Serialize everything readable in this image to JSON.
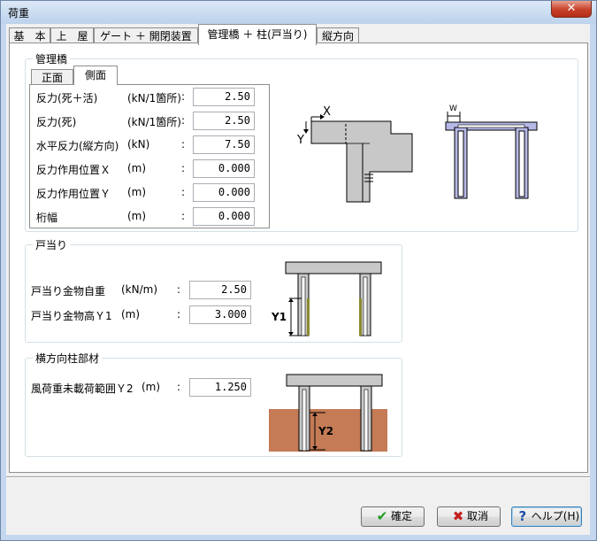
{
  "window": {
    "title": "荷重"
  },
  "tabs": [
    {
      "label": "基　本"
    },
    {
      "label": "上　屋"
    },
    {
      "label": "ゲート ＋ 開閉装置"
    },
    {
      "label": "管理橋 ＋ 柱(戸当り)"
    },
    {
      "label": "縦方向"
    }
  ],
  "group_kanri": {
    "title": "管理橋",
    "subtabs": [
      {
        "label": "正面"
      },
      {
        "label": "側面"
      }
    ],
    "rows": [
      {
        "label": "反力(死＋活)",
        "unit": "(kN/1箇所)",
        "colon": ":",
        "value": "2.50"
      },
      {
        "label": "反力(死)",
        "unit": "(kN/1箇所)",
        "colon": ":",
        "value": "2.50"
      },
      {
        "label": "水平反力(縦方向)",
        "unit": "(kN)",
        "colon": ":",
        "value": "7.50"
      },
      {
        "label": "反力作用位置Ｘ",
        "unit": "(m)",
        "colon": ":",
        "value": "0.000"
      },
      {
        "label": "反力作用位置Ｙ",
        "unit": "(m)",
        "colon": ":",
        "value": "0.000"
      },
      {
        "label": "桁幅",
        "unit": "(m)",
        "colon": ":",
        "value": "0.000"
      }
    ],
    "diagram1": {
      "x_label": "X",
      "y_label": "Y"
    },
    "diagram2": {
      "w_label": "W"
    }
  },
  "group_toatari": {
    "title": "戸当り",
    "rows": [
      {
        "label": "戸当り金物自重",
        "unit": "(kN/m)",
        "colon": ":",
        "value": "2.50"
      },
      {
        "label": "戸当り金物高Ｙ1",
        "unit": "(m)",
        "colon": ":",
        "value": "3.000"
      }
    ],
    "diagram": {
      "y_label": "Y1"
    }
  },
  "group_yoko": {
    "title": "横方向柱部材",
    "rows": [
      {
        "label": "風荷重未載荷範囲Ｙ2",
        "unit": "(m)",
        "colon": ":",
        "value": "1.250"
      }
    ],
    "diagram": {
      "y_label": "Y2"
    }
  },
  "buttons": {
    "ok": "確定",
    "cancel": "取消",
    "help": "ヘルプ(H)"
  },
  "colors": {
    "diagram_gray": "#c8c8c8",
    "diagram_blue_fill": "#b6b8e6",
    "soil": "#c47b56",
    "rail_olive": "#8a8a30"
  }
}
